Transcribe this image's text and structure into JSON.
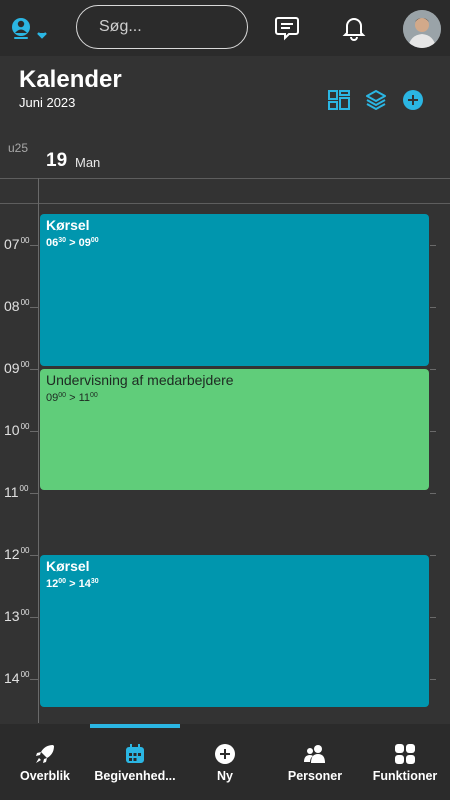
{
  "topbar": {
    "search_placeholder": "Søg...",
    "icons": [
      "globe-user-icon",
      "chevron-down-icon",
      "message-icon",
      "bell-icon"
    ]
  },
  "header": {
    "title": "Kalender",
    "subtitle": "Juni 2023",
    "icons": [
      "dashboard-icon",
      "layers-icon",
      "add-circle-icon"
    ],
    "week": "u25",
    "day_number": "19",
    "day_name": "Man"
  },
  "hours": [
    {
      "h": "07",
      "m": "00"
    },
    {
      "h": "08",
      "m": "00"
    },
    {
      "h": "09",
      "m": "00"
    },
    {
      "h": "10",
      "m": "00"
    },
    {
      "h": "11",
      "m": "00"
    },
    {
      "h": "12",
      "m": "00"
    },
    {
      "h": "13",
      "m": "00"
    },
    {
      "h": "14",
      "m": "00"
    }
  ],
  "events": [
    {
      "title": "Kørsel",
      "start_h": "06",
      "start_m": "30",
      "sep": " > ",
      "end_h": "09",
      "end_m": "00",
      "color": "#0096ae"
    },
    {
      "title": "Undervisning af medarbejdere",
      "start_h": "09",
      "start_m": "00",
      "sep": " > ",
      "end_h": "11",
      "end_m": "00",
      "color": "#60cd7a"
    },
    {
      "title": "Kørsel",
      "start_h": "12",
      "start_m": "00",
      "sep": " > ",
      "end_h": "14",
      "end_m": "30",
      "color": "#0096ae"
    }
  ],
  "tabs": [
    {
      "label": "Overblik",
      "icon": "rocket-icon"
    },
    {
      "label": "Begivenhed...",
      "icon": "calendar-icon",
      "active": true
    },
    {
      "label": "Ny",
      "icon": "add-circle-icon"
    },
    {
      "label": "Personer",
      "icon": "people-icon"
    },
    {
      "label": "Funktioner",
      "icon": "grid-icon"
    }
  ],
  "colors": {
    "accent": "#2bb6e3",
    "event_blue": "#0096ae",
    "event_green": "#60cd7a",
    "background": "#333333",
    "bar": "#2b2b2b"
  }
}
